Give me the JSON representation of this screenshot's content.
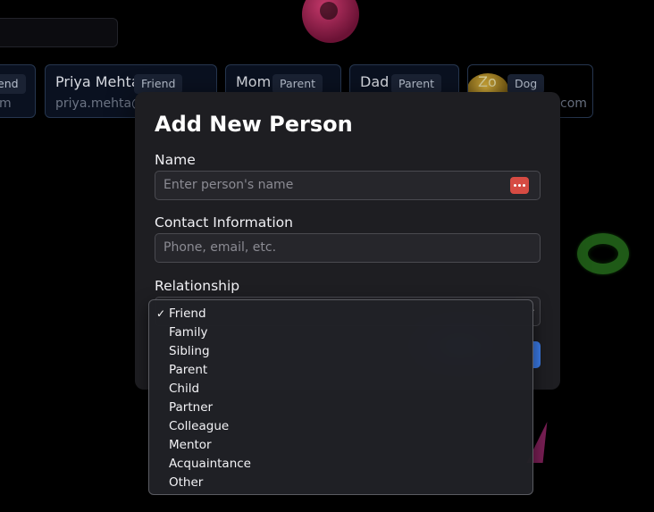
{
  "background": {
    "cards": [
      {
        "name": "",
        "tag": "end",
        "sub": "m"
      },
      {
        "name": "Priya Mehta",
        "tag": "Friend",
        "sub": "priya.mehta@"
      },
      {
        "name": "Mom",
        "tag": "Parent",
        "sub": ""
      },
      {
        "name": "Dad",
        "tag": "Parent",
        "sub": ""
      },
      {
        "name": "Zo",
        "tag": "Dog",
        "sub": "com"
      }
    ]
  },
  "modal": {
    "title": "Add New Person",
    "name_label": "Name",
    "name_placeholder": "Enter person's name",
    "contact_label": "Contact Information",
    "contact_placeholder": "Phone, email, etc.",
    "relationship_label": "Relationship"
  },
  "dropdown": {
    "selected": "Friend",
    "options": [
      "Friend",
      "Family",
      "Sibling",
      "Parent",
      "Child",
      "Partner",
      "Colleague",
      "Mentor",
      "Acquaintance",
      "Other"
    ]
  },
  "colors": {
    "accent": "#3b7be8",
    "modal_bg": "#1e1e22",
    "password_badge": "#d64b43"
  }
}
